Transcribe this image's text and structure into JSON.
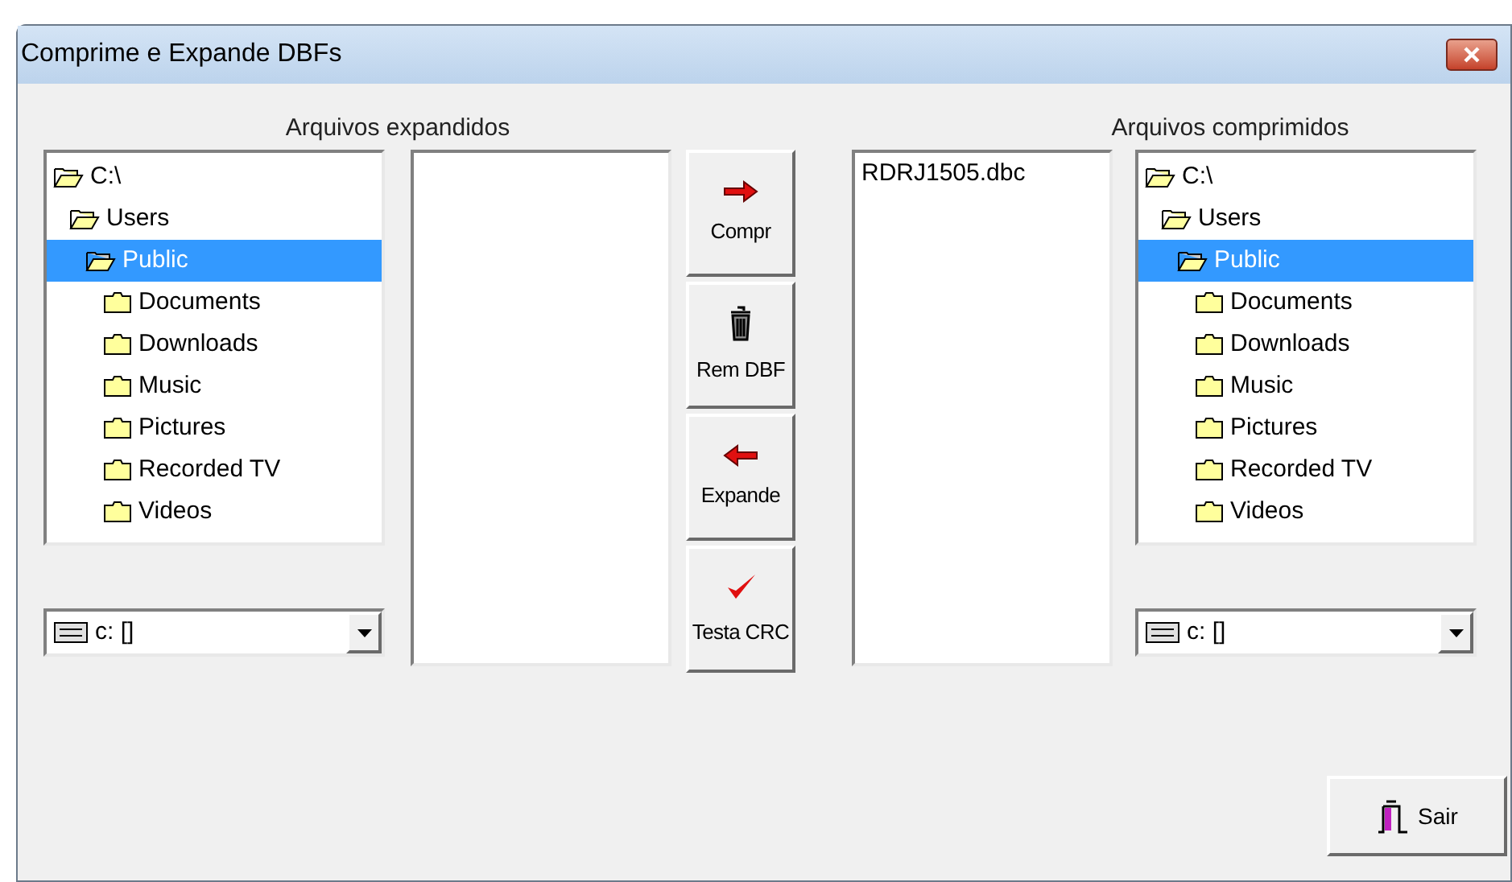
{
  "window": {
    "title": "Comprime e Expande DBFs"
  },
  "expanded_panel": {
    "heading": "Arquivos expandidos",
    "tree": [
      {
        "label": "C:\\",
        "selected": false,
        "expanded": true,
        "children": [
          {
            "label": "Users",
            "selected": false,
            "expanded": true,
            "children": [
              {
                "label": "Public",
                "selected": true,
                "expanded": true,
                "children": [
                  {
                    "label": "Documents",
                    "selected": false,
                    "expanded": false
                  },
                  {
                    "label": "Downloads",
                    "selected": false,
                    "expanded": false
                  },
                  {
                    "label": "Music",
                    "selected": false,
                    "expanded": false
                  },
                  {
                    "label": "Pictures",
                    "selected": false,
                    "expanded": false
                  },
                  {
                    "label": "Recorded TV",
                    "selected": false,
                    "expanded": false
                  },
                  {
                    "label": "Videos",
                    "selected": false,
                    "expanded": false
                  }
                ]
              }
            ]
          }
        ]
      }
    ],
    "drive": "c: []"
  },
  "actions": [
    {
      "kind": "right-arrow",
      "label": "Compr"
    },
    {
      "kind": "trash",
      "label": "Rem DBF"
    },
    {
      "kind": "left-arrow",
      "label": "Expande"
    },
    {
      "kind": "check",
      "label": "Testa CRC"
    }
  ],
  "compressed_panel": {
    "heading": "Arquivos comprimidos",
    "files": [
      "RDRJ1505.dbc"
    ],
    "tree": [
      {
        "label": "C:\\",
        "selected": false,
        "expanded": true,
        "children": [
          {
            "label": "Users",
            "selected": false,
            "expanded": true,
            "children": [
              {
                "label": "Public",
                "selected": true,
                "expanded": true,
                "children": [
                  {
                    "label": "Documents",
                    "selected": false,
                    "expanded": false
                  },
                  {
                    "label": "Downloads",
                    "selected": false,
                    "expanded": false
                  },
                  {
                    "label": "Music",
                    "selected": false,
                    "expanded": false
                  },
                  {
                    "label": "Pictures",
                    "selected": false,
                    "expanded": false
                  },
                  {
                    "label": "Recorded TV",
                    "selected": false,
                    "expanded": false
                  },
                  {
                    "label": "Videos",
                    "selected": false,
                    "expanded": false
                  }
                ]
              }
            ]
          }
        ]
      }
    ],
    "drive": "c: []"
  },
  "exit_button": {
    "label": "Sair"
  }
}
